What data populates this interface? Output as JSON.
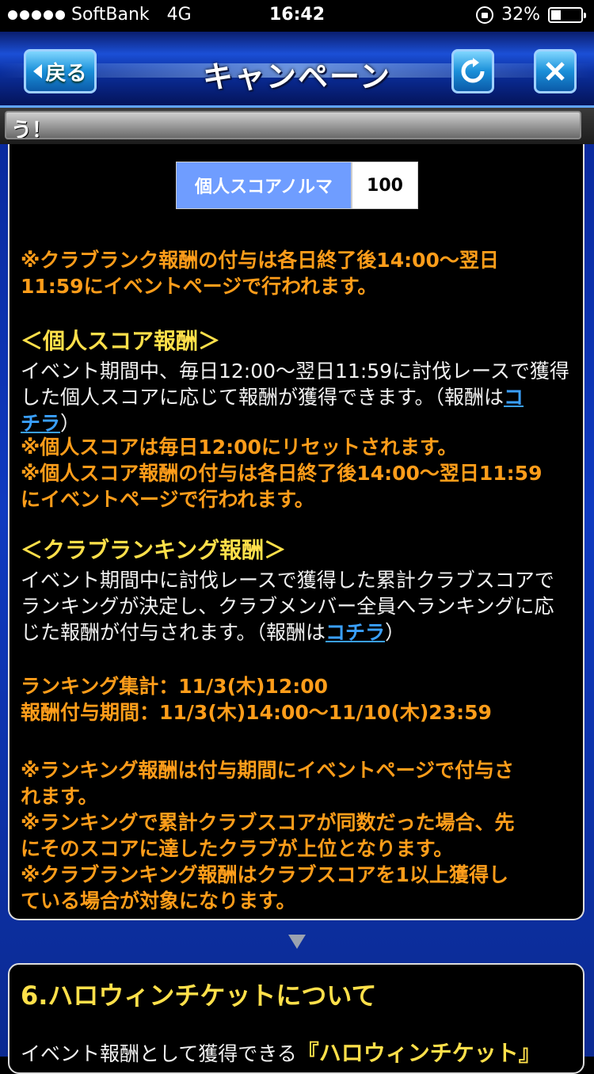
{
  "status": {
    "carrier": "SoftBank",
    "network": "4G",
    "time": "16:42",
    "battery": "32%",
    "battery_level": 0.32
  },
  "header": {
    "back_label": "戻る",
    "title": "キャンペーン",
    "reload_icon": "reload-icon",
    "close_icon": "close-icon"
  },
  "ticker": {
    "text": "う！"
  },
  "norma": {
    "label": "個人スコアノルマ",
    "value": "100"
  },
  "content": {
    "note_club_rank": [
      "※クラブランク報酬の付与は各日終了後14:00〜翌日",
      "11:59にイベントページで行われます。"
    ],
    "personal_heading": "＜個人スコア報酬＞",
    "personal_desc": [
      "イベント期間中、毎日12:00〜翌日11:59に討伐レースで獲得",
      "した個人スコアに応じて報酬が獲得できます。（報酬は",
      "コ",
      "チラ",
      "）"
    ],
    "personal_notes": [
      "※個人スコアは毎日12:00にリセットされます。",
      "※個人スコア報酬の付与は各日終了後14:00〜翌日11:59",
      "にイベントページで行われます。"
    ],
    "ranking_heading": "＜クラブランキング報酬＞",
    "ranking_desc": [
      "イベント期間中に討伐レースで獲得した累計クラブスコアで",
      "ランキングが決定し、クラブメンバー全員へランキングに応",
      "じた報酬が付与されます。（報酬は",
      "コチラ",
      "）"
    ],
    "schedule": [
      "ランキング集計：11/3(木)12:00",
      "報酬付与期間：11/3(木)14:00〜11/10(木)23:59"
    ],
    "ranking_notes": [
      "※ランキング報酬は付与期間にイベントページで付与さ",
      "れます。",
      "※ランキングで累計クラブスコアが同数だった場合、先",
      "にそのスコアに達したクラブが上位となります。",
      "※クラブランキング報酬はクラブスコアを1以上獲得し",
      "ている場合が対象になります。"
    ]
  },
  "section6": {
    "title": "6.ハロウィンチケットについて",
    "text": "イベント報酬として獲得できる",
    "highlight": "『ハロウィンチケット』"
  },
  "colors": {
    "orange": "#ff9d1a",
    "yellow": "#ffe04a",
    "link": "#3aa0ff",
    "header_blue": "#1b4fd6",
    "norma_blue": "#6f9dff"
  }
}
